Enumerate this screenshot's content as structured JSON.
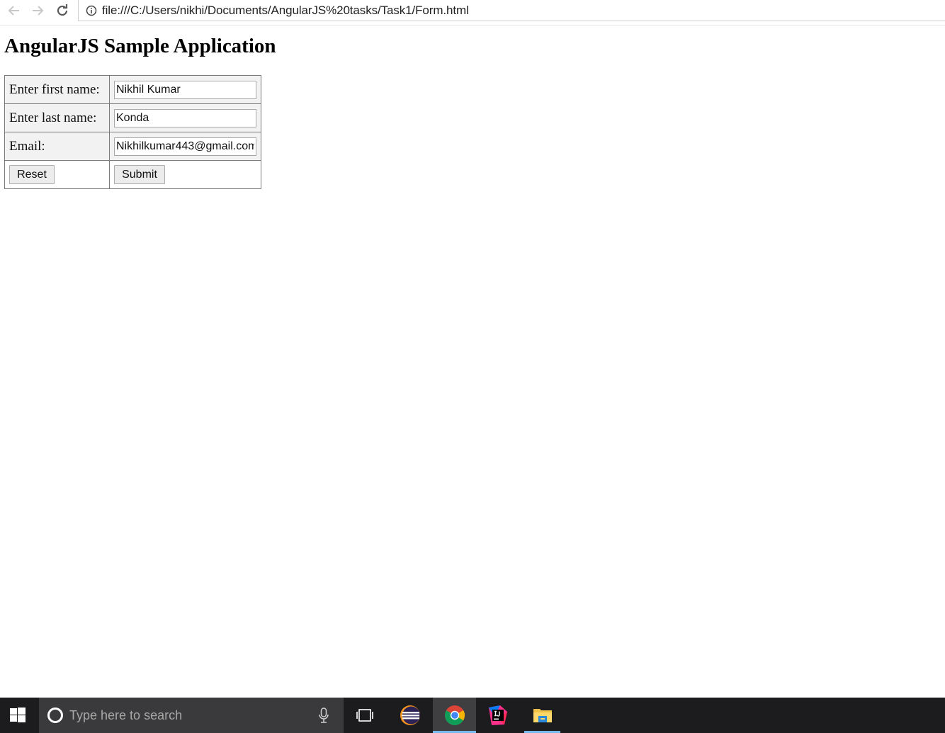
{
  "browser": {
    "url": "file:///C:/Users/nikhi/Documents/AngularJS%20tasks/Task1/Form.html",
    "back_icon": "arrow-left-icon",
    "forward_icon": "arrow-right-icon",
    "reload_icon": "reload-icon",
    "info_icon": "info-icon"
  },
  "page": {
    "title": "AngularJS Sample Application",
    "form": {
      "first_name_label": "Enter first name:",
      "first_name_value": "Nikhil Kumar",
      "last_name_label": "Enter last name:",
      "last_name_value": "Konda",
      "email_label": "Email:",
      "email_value": "Nikhilkumar443@gmail.com",
      "reset_label": "Reset",
      "submit_label": "Submit"
    }
  },
  "taskbar": {
    "search_placeholder": "Type here to search",
    "apps": [
      "windows-start-icon",
      "task-view-icon",
      "eclipse-icon",
      "chrome-icon",
      "intellij-icon",
      "file-explorer-icon"
    ],
    "accent_color": "#76b9ed"
  }
}
